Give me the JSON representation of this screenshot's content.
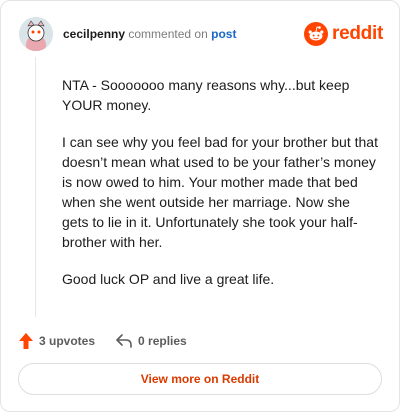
{
  "comment": {
    "username": "cecilpenny",
    "commented_on_text": "commented on",
    "post_link_label": "post",
    "paragraphs": [
      "NTA - Sooooooo many reasons why...but keep YOUR money.",
      "I can see why you feel bad for your brother but that doesn’t mean what used to be your father’s money is now owed to him. Your mother made that bed when she went outside her marriage. Now she gets to lie in it. Unfortunately she took your half-brother with her.",
      "Good luck OP and live a great life."
    ]
  },
  "brand": {
    "name": "reddit",
    "color": "#ff4500",
    "icon": "reddit-logo-icon"
  },
  "actions": {
    "upvotes_label": "3 upvotes",
    "upvote_icon": "upvote-arrow-icon",
    "upvote_color": "#ff4500",
    "replies_label": "0 replies",
    "reply_icon": "reply-arrow-icon"
  },
  "cta": {
    "label": "View more on Reddit",
    "color": "#d93a00"
  }
}
